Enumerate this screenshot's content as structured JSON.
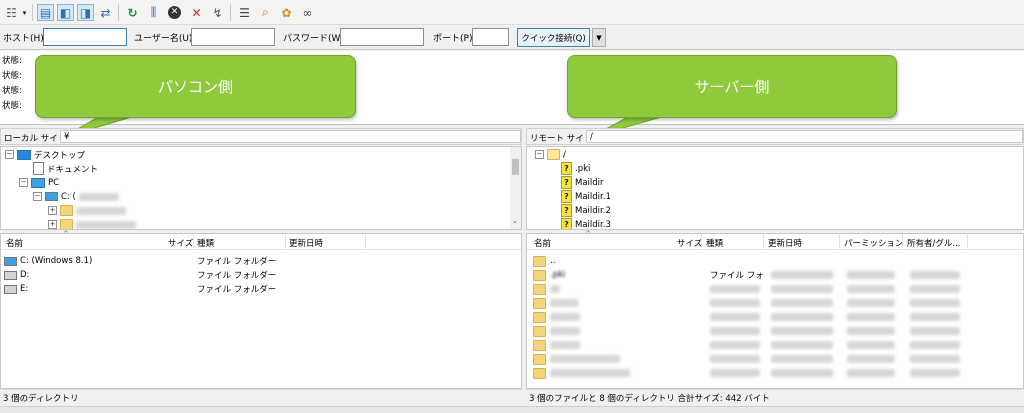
{
  "toolbar": {
    "icons": [
      "site-manager-icon",
      "dropdown-arrow-icon",
      "message-log-toggle-icon",
      "local-tree-toggle-icon",
      "remote-tree-toggle-icon",
      "transfer-queue-toggle-icon",
      "refresh-icon",
      "filter-icon",
      "cancel-icon",
      "disconnect-icon",
      "reconnect-icon",
      "directory-comparison-icon",
      "search-icon",
      "sync-browsing-icon",
      "binoculars-icon"
    ]
  },
  "quickconnect": {
    "host_label": "ホスト(H):",
    "user_label": "ユーザー名(U):",
    "password_label": "パスワード(W):",
    "port_label": "ポート(P):",
    "button_label": "クイック接続(Q)",
    "host_value": "",
    "user_value": "",
    "password_value": "",
    "port_value": ""
  },
  "log": {
    "lines": [
      "状態:",
      "状態:",
      "状態:",
      "状態:"
    ]
  },
  "callouts": {
    "left": "パソコン側",
    "right": "サーバー側"
  },
  "local": {
    "site_label": "ローカル サイト:",
    "path": "¥",
    "tree": [
      {
        "label": "デスクトップ"
      },
      {
        "label": "ドキュメント"
      },
      {
        "label": "PC"
      },
      {
        "label": "C: ("
      }
    ],
    "columns": [
      "名前",
      "サイズ",
      "種類",
      "更新日時"
    ],
    "files": [
      {
        "name": "C: (Windows 8.1)",
        "type": "ファイル フォルダー"
      },
      {
        "name": "D:",
        "type": "ファイル フォルダー"
      },
      {
        "name": "E:",
        "type": "ファイル フォルダー"
      }
    ],
    "status": "3 個のディレクトリ"
  },
  "remote": {
    "site_label": "リモート サイト:",
    "path": "/",
    "tree": [
      {
        "label": "/"
      },
      {
        "label": ".pki"
      },
      {
        "label": "Maildir"
      },
      {
        "label": "Maildir.1"
      },
      {
        "label": "Maildir.2"
      },
      {
        "label": "Maildir.3"
      }
    ],
    "columns": [
      "名前",
      "サイズ",
      "種類",
      "更新日時",
      "パーミッション",
      "所有者/グル..."
    ],
    "files": [
      {
        "name": ".."
      },
      {
        "name": ".pki",
        "type": "ファイル フォ"
      }
    ],
    "status": "3 個のファイルと 8 個のディレクトリ 合計サイズ: 442 バイト"
  }
}
